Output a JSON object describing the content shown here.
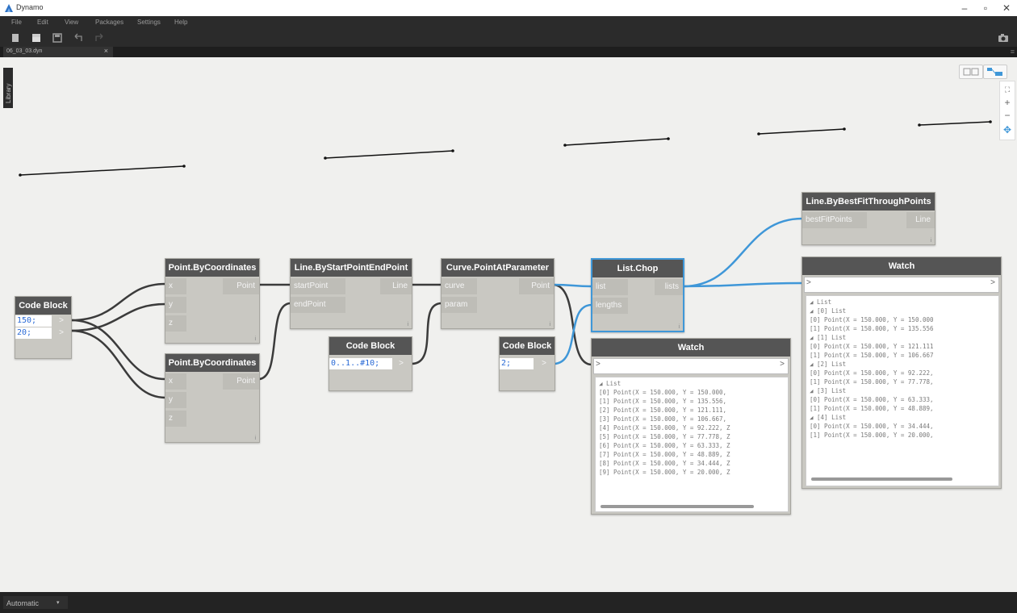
{
  "window": {
    "title": "Dynamo",
    "controls": [
      "–",
      "▫",
      "✕"
    ]
  },
  "menu": [
    "File",
    "Edit",
    "View",
    "Packages",
    "Settings",
    "Help"
  ],
  "tab": {
    "label": "06_03_03.dyn",
    "close": "×"
  },
  "library_label": "Library",
  "status": {
    "run_mode": "Automatic",
    "arrow": "▾"
  },
  "zoom": {
    "fit": "⛶",
    "in": "+",
    "out": "−",
    "pan": "✥"
  },
  "nodes": {
    "codeblock1": {
      "title": "Code Block",
      "lines": [
        "150;",
        "20;"
      ],
      "out": ">"
    },
    "pointA": {
      "title": "Point.ByCoordinates",
      "inputs": [
        "x",
        "y",
        "z"
      ],
      "output": "Point"
    },
    "pointB": {
      "title": "Point.ByCoordinates",
      "inputs": [
        "x",
        "y",
        "z"
      ],
      "output": "Point"
    },
    "line": {
      "title": "Line.ByStartPointEndPoint",
      "inputs": [
        "startPoint",
        "endPoint"
      ],
      "output": "Line"
    },
    "codeblock2": {
      "title": "Code Block",
      "lines": [
        "0..1..#10;"
      ],
      "out": ">"
    },
    "curve": {
      "title": "Curve.PointAtParameter",
      "inputs": [
        "curve",
        "param"
      ],
      "output": "Point"
    },
    "codeblock3": {
      "title": "Code Block",
      "lines": [
        "2;"
      ],
      "out": ">"
    },
    "chop": {
      "title": "List.Chop",
      "inputs": [
        "list",
        "lengths"
      ],
      "output": "lists"
    },
    "bestfit": {
      "title": "Line.ByBestFitThroughPoints",
      "inputs": [
        "bestFitPoints"
      ],
      "output": "Line"
    },
    "watch1": {
      "title": "Watch",
      "in": ">",
      "out": ">",
      "lines": [
        "◢ List",
        "    [0] Point(X = 150.000, Y = 150.000,",
        "    [1] Point(X = 150.000, Y = 135.556,",
        "    [2] Point(X = 150.000, Y = 121.111,",
        "    [3] Point(X = 150.000, Y = 106.667,",
        "    [4] Point(X = 150.000, Y = 92.222, Z",
        "    [5] Point(X = 150.000, Y = 77.778, Z",
        "    [6] Point(X = 150.000, Y = 63.333, Z",
        "    [7] Point(X = 150.000, Y = 48.889, Z",
        "    [8] Point(X = 150.000, Y = 34.444, Z",
        "    [9] Point(X = 150.000, Y = 20.000, Z"
      ]
    },
    "watch2": {
      "title": "Watch",
      "in": ">",
      "out": ">",
      "lines": [
        "◢ List",
        "  ◢ [0] List",
        "      [0] Point(X = 150.000, Y = 150.000",
        "      [1] Point(X = 150.000, Y = 135.556",
        "  ◢ [1] List",
        "      [0] Point(X = 150.000, Y = 121.111",
        "      [1] Point(X = 150.000, Y = 106.667",
        "  ◢ [2] List",
        "      [0] Point(X = 150.000, Y = 92.222,",
        "      [1] Point(X = 150.000, Y = 77.778,",
        "  ◢ [3] List",
        "      [0] Point(X = 150.000, Y = 63.333,",
        "      [1] Point(X = 150.000, Y = 48.889,",
        "  ◢ [4] List",
        "      [0] Point(X = 150.000, Y = 34.444,",
        "      [1] Point(X = 150.000, Y = 20.000,"
      ]
    }
  },
  "colors": {
    "wire_default": "#3b3b3b",
    "wire_selected": "#3f97d8",
    "canvas": "#f0f0ee",
    "header": "#555555"
  }
}
